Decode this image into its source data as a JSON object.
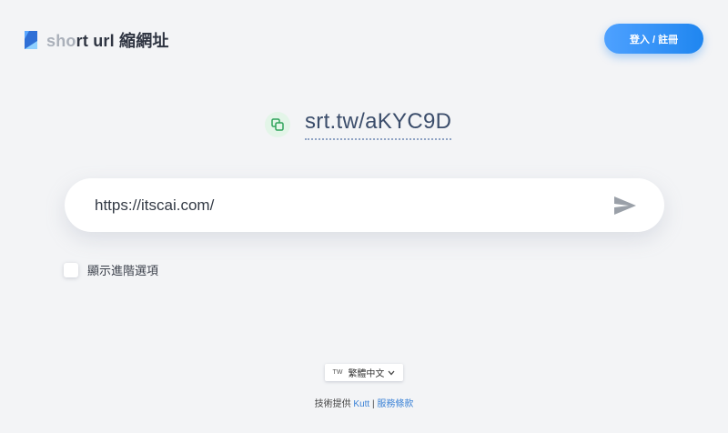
{
  "header": {
    "logo_dim": "sho",
    "logo_rest": "rt url 縮網址",
    "login_label": "登入 / 註冊"
  },
  "result": {
    "short_url": "srt.tw/aKYC9D"
  },
  "url_input": {
    "value": "https://itscai.com/"
  },
  "advanced": {
    "label": "顯示進階選項"
  },
  "footer": {
    "lang_code": "TW",
    "lang_label": "繁體中文",
    "powered_by": "技術提供",
    "kutt_link": "Kutt",
    "separator": "|",
    "terms_link": "服務條款"
  },
  "colors": {
    "accent": "#1f86f0",
    "background": "#f3f4f6",
    "copy_bg": "#e3f5e8",
    "link": "#3b82d6"
  }
}
